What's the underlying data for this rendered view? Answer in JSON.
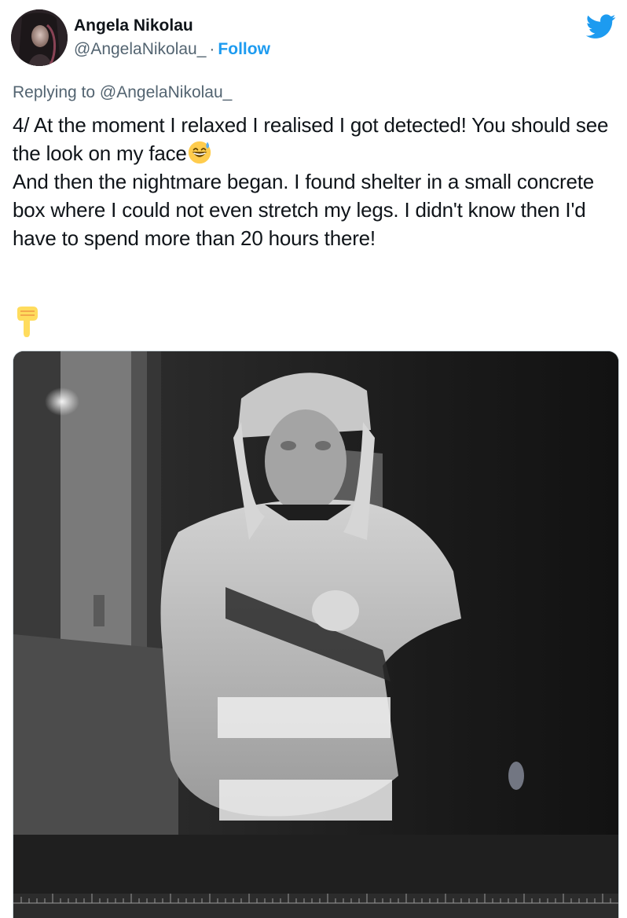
{
  "author": {
    "display_name": "Angela Nikolau",
    "handle": "@AngelaNikolau_",
    "separator": "·",
    "follow_label": "Follow"
  },
  "reply": {
    "prefix": "Replying to ",
    "handle": "@AngelaNikolau_"
  },
  "tweet": {
    "line1": "4/ At the moment I relaxed I realised I got detected! You should see the look on my face",
    "emoji_inline": "grinning-face-with-sweat-emoji",
    "line2": "And then the nightmare began. I found shelter in a small concrete box where I could not even stretch my legs. I didn't know then I'd have to spend more than 20 hours there!",
    "emoji_after": "backhand-index-pointing-down-emoji"
  },
  "icons": {
    "brand": "twitter-bird-icon"
  },
  "colors": {
    "accent": "#1d9bf0",
    "text": "#0f1419",
    "secondary": "#536471"
  }
}
